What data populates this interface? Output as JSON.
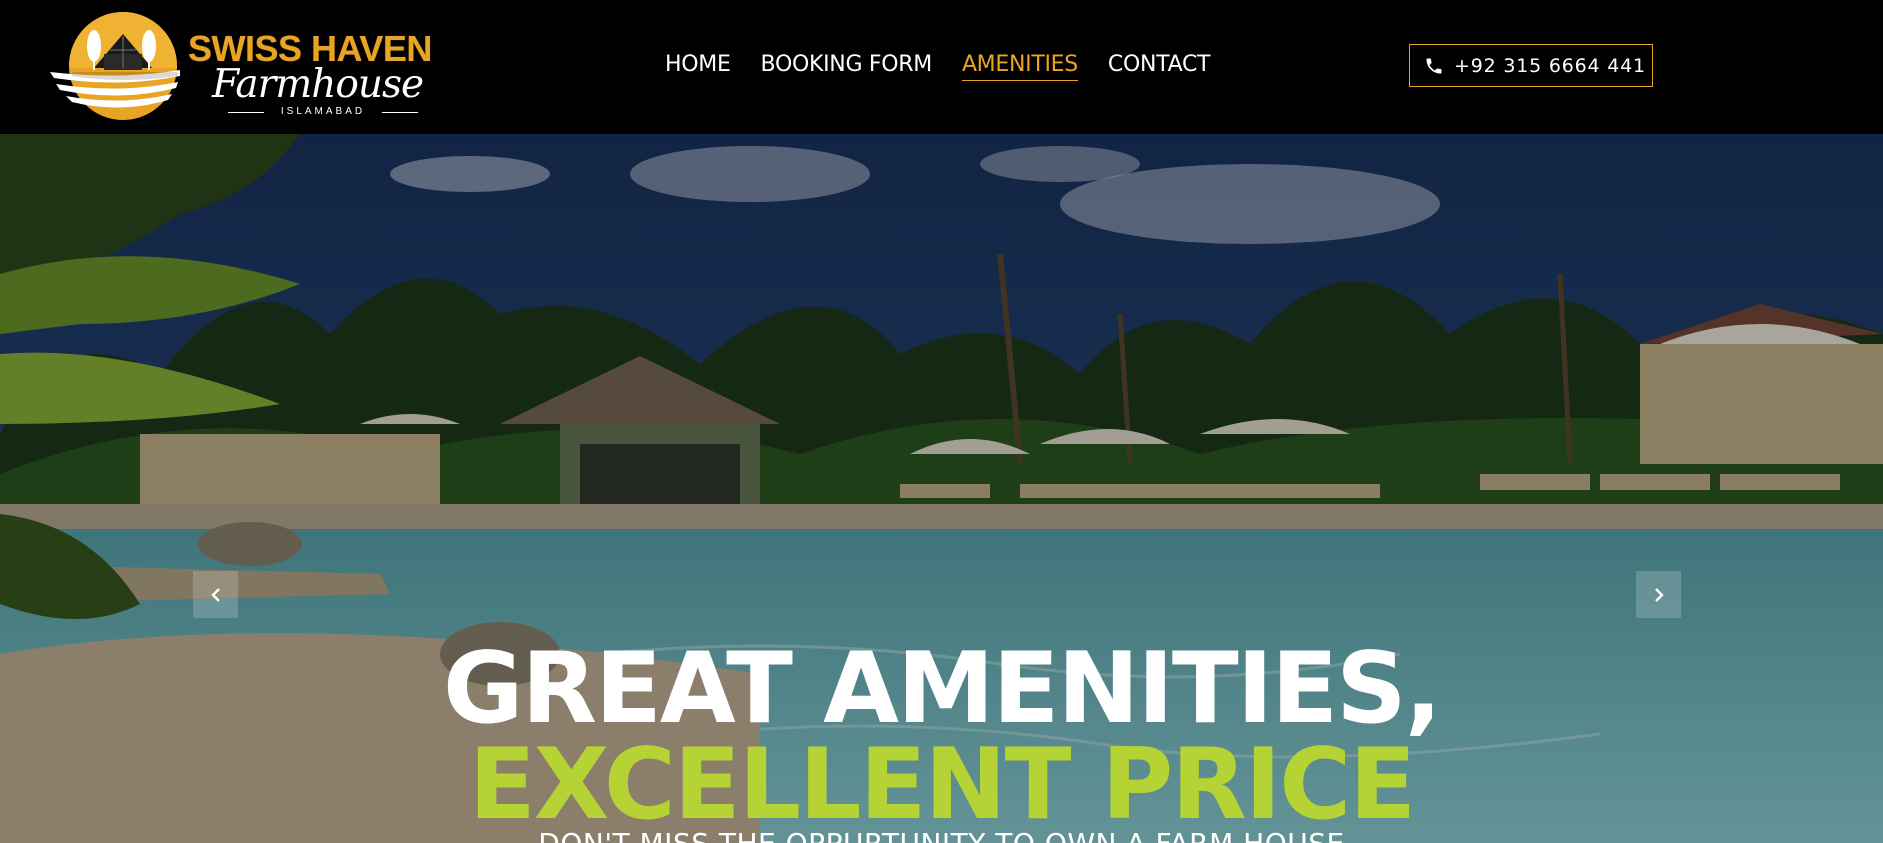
{
  "brand": {
    "name_line1": "SWISS HAVEN",
    "name_line2": "Farmhouse",
    "name_line3": "ISLAMABAD",
    "accent_color": "#e8a424"
  },
  "nav": {
    "items": [
      {
        "label": "HOME",
        "active": false
      },
      {
        "label": "BOOKING FORM",
        "active": false
      },
      {
        "label": "AMENITIES",
        "active": true
      },
      {
        "label": "CONTACT",
        "active": false
      }
    ],
    "active_color": "#e8a424"
  },
  "phone": {
    "icon": "phone-icon",
    "number": "+92 315 6664 441"
  },
  "hero": {
    "title_line1": "GREAT AMENITIES,",
    "title_line2": "EXCELLENT PRICE",
    "subtitle": "DON'T MISS THE OPPURTUNITY TO OWN A FARM HOUSE",
    "title_line2_color": "#b5d334",
    "prev_icon": "chevron-left-icon",
    "next_icon": "chevron-right-icon"
  }
}
